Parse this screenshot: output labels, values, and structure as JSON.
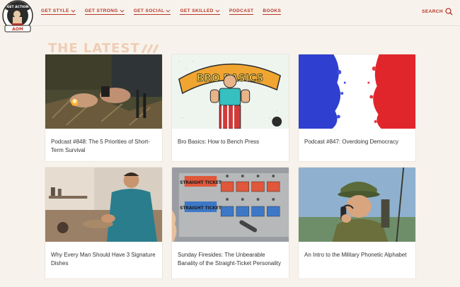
{
  "header": {
    "logo_alt": "Get Action AOM",
    "nav": [
      {
        "label": "GET STYLE",
        "has_dropdown": true
      },
      {
        "label": "GET STRONG",
        "has_dropdown": true
      },
      {
        "label": "GET SOCIAL",
        "has_dropdown": true
      },
      {
        "label": "GET SKILLED",
        "has_dropdown": true
      },
      {
        "label": "PODCAST",
        "has_dropdown": false
      },
      {
        "label": "BOOKS",
        "has_dropdown": false
      }
    ],
    "search_label": "SEARCH",
    "accent_color": "#b8372b"
  },
  "section": {
    "title": "THE LATEST"
  },
  "articles": [
    {
      "title": "Podcast #848: The 5 Priorities of Short-Term Survival",
      "image": "fire-starting-hands"
    },
    {
      "title": "Bro Basics: How to Bench Press",
      "image": "bro-basics-illustration"
    },
    {
      "title": "Podcast #847: Overdoing Democracy",
      "image": "tricolor-paint-splash"
    },
    {
      "title": "Why Every Man Should Have 3 Signature Dishes",
      "image": "man-cooking-kitchen"
    },
    {
      "title": "Sunday Firesides: The Unbearable Banality of the Straight-Ticket Personality",
      "image": "straight-ticket-voting-machine"
    },
    {
      "title": "An Intro to the Military Phonetic Alphabet",
      "image": "soldier-radio-phone"
    }
  ]
}
